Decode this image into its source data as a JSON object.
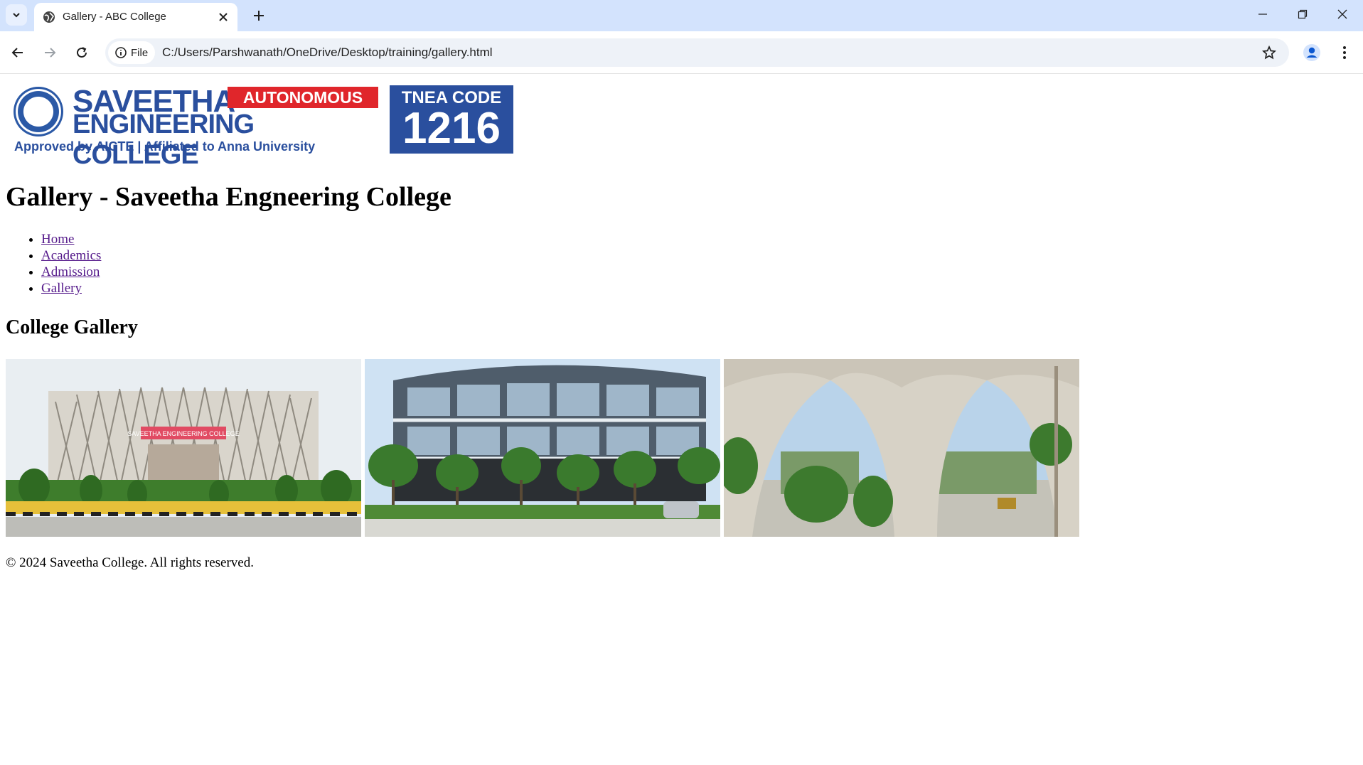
{
  "browser": {
    "tab_title": "Gallery - ABC College",
    "site_chip": "File",
    "url": "C:/Users/Parshwanath/OneDrive/Desktop/training/gallery.html"
  },
  "logo": {
    "name_line1": "SAVEETHA",
    "badge": "AUTONOMOUS",
    "name_line2": "ENGINEERING COLLEGE",
    "tagline": "Approved by AICTE  |  Affiliated to Anna University",
    "code_label": "TNEA CODE",
    "code_value": "1216"
  },
  "page": {
    "title": "Gallery - Saveetha Engneering College",
    "nav": [
      "Home",
      "Academics",
      "Admission",
      "Gallery"
    ],
    "section_title": "College Gallery",
    "footer": "© 2024 Saveetha College. All rights reserved."
  },
  "gallery": {
    "photo1_sign": "SAVEETHA ENGINEERING COLLEGE"
  }
}
